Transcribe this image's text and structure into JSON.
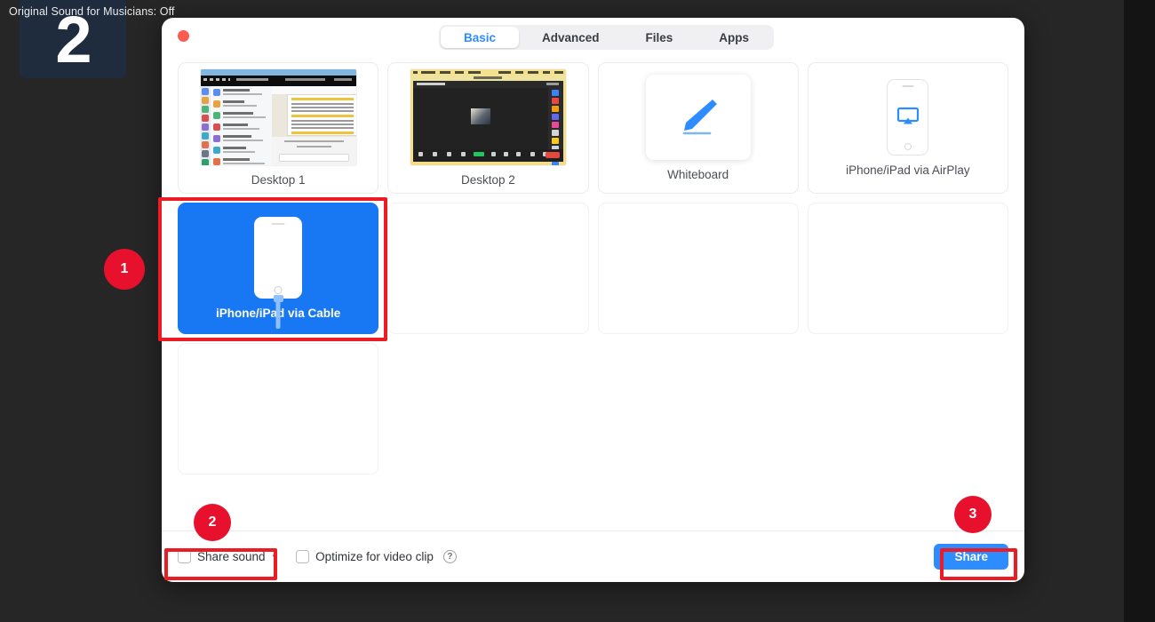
{
  "meeting_overlay": {
    "original_sound_label": "Original Sound for Musicians: Off",
    "participant_tile_number": "2"
  },
  "dialog": {
    "title_dot": "close-red",
    "tabs": [
      {
        "label": "Basic",
        "active": true
      },
      {
        "label": "Advanced",
        "active": false
      },
      {
        "label": "Files",
        "active": false
      },
      {
        "label": "Apps",
        "active": false
      }
    ],
    "tiles": [
      {
        "label": "Desktop 1",
        "kind": "desktop1",
        "selected": false
      },
      {
        "label": "Desktop 2",
        "kind": "desktop2",
        "selected": false
      },
      {
        "label": "Whiteboard",
        "kind": "whiteboard",
        "selected": false
      },
      {
        "label": "iPhone/iPad via AirPlay",
        "kind": "airplay",
        "selected": false
      },
      {
        "label": "iPhone/iPad via Cable",
        "kind": "cable",
        "selected": true
      },
      {
        "label": "",
        "kind": "empty",
        "selected": false
      },
      {
        "label": "",
        "kind": "empty",
        "selected": false
      },
      {
        "label": "",
        "kind": "empty",
        "selected": false
      },
      {
        "label": "",
        "kind": "empty",
        "selected": false
      }
    ],
    "footer": {
      "share_sound_label": "Share sound",
      "share_sound_chevron": "chevron-down",
      "optimize_label": "Optimize for video clip",
      "help_glyph": "?",
      "share_button_label": "Share"
    }
  },
  "annotations": [
    {
      "number": "1",
      "target": "iphone-ipad-via-cable-tile"
    },
    {
      "number": "2",
      "target": "share-sound-option"
    },
    {
      "number": "3",
      "target": "share-button"
    }
  ],
  "colors": {
    "accent_blue": "#2d8cff",
    "selected_tile_blue": "#1877f2",
    "annotation_red": "#e8112d",
    "annotation_box_red": "#ed1c24",
    "background_dark": "#262626",
    "participant_tile": "#1e2c3d"
  }
}
